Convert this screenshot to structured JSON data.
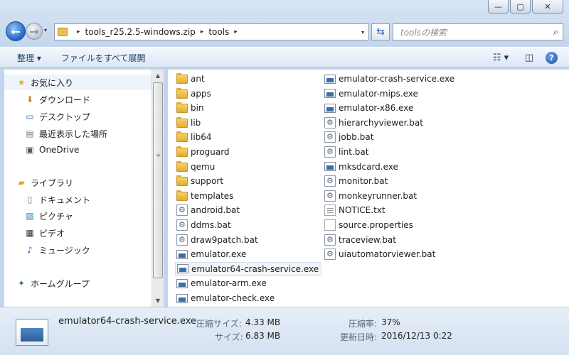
{
  "titlebar": {
    "minimize": "—",
    "maximize": "▢",
    "close": "✕"
  },
  "nav": {
    "back_icon": "←",
    "forward_icon": "→",
    "dropdown_icon": "▾"
  },
  "address": {
    "path": [
      "tools_r25.2.5-windows.zip",
      "tools"
    ],
    "separator": "▸",
    "dropdown": "▾"
  },
  "search": {
    "placeholder": "toolsの検索",
    "icon": "⌕"
  },
  "toolbar": {
    "organize": "整理 ▾",
    "expand_all": "ファイルをすべて展開",
    "view_icon": "☷ ▾",
    "preview_icon": "◫",
    "help": "?"
  },
  "sidebar": {
    "items": [
      {
        "label": "お気に入り",
        "icon": "★",
        "color": "#e3b024"
      },
      {
        "label": "ダウンロード",
        "icon": "⬇",
        "color": "#c58a24"
      },
      {
        "label": "デスクトップ",
        "icon": "▭",
        "color": "#2a5da8"
      },
      {
        "label": "最近表示した場所",
        "icon": "▤",
        "color": "#7a7a7a"
      },
      {
        "label": "OneDrive",
        "icon": "▣",
        "color": "#555555"
      },
      {
        "label": "ライブラリ",
        "icon": "▰",
        "color": "#d9a227"
      },
      {
        "label": "ドキュメント",
        "icon": "▯",
        "color": "#6a7a8c"
      },
      {
        "label": "ピクチャ",
        "icon": "▨",
        "color": "#2f7aa8"
      },
      {
        "label": "ビデオ",
        "icon": "▦",
        "color": "#333333"
      },
      {
        "label": "ミュージック",
        "icon": "♪",
        "color": "#2a6ec0"
      },
      {
        "label": "ホームグループ",
        "icon": "✦",
        "color": "#2e8b57"
      }
    ]
  },
  "files": {
    "col1": [
      {
        "name": "ant",
        "type": "folder"
      },
      {
        "name": "apps",
        "type": "folder"
      },
      {
        "name": "bin",
        "type": "folder"
      },
      {
        "name": "lib",
        "type": "folder"
      },
      {
        "name": "lib64",
        "type": "folder"
      },
      {
        "name": "proguard",
        "type": "folder"
      },
      {
        "name": "qemu",
        "type": "folder"
      },
      {
        "name": "support",
        "type": "folder"
      },
      {
        "name": "templates",
        "type": "folder"
      },
      {
        "name": "android.bat",
        "type": "bat"
      },
      {
        "name": "ddms.bat",
        "type": "bat"
      },
      {
        "name": "draw9patch.bat",
        "type": "bat"
      },
      {
        "name": "emulator.exe",
        "type": "exe"
      },
      {
        "name": "emulator64-crash-service.exe",
        "type": "exe"
      },
      {
        "name": "emulator-arm.exe",
        "type": "exe"
      },
      {
        "name": "emulator-check.exe",
        "type": "exe"
      }
    ],
    "col2": [
      {
        "name": "emulator-crash-service.exe",
        "type": "exe"
      },
      {
        "name": "emulator-mips.exe",
        "type": "exe"
      },
      {
        "name": "emulator-x86.exe",
        "type": "exe"
      },
      {
        "name": "hierarchyviewer.bat",
        "type": "bat"
      },
      {
        "name": "jobb.bat",
        "type": "bat"
      },
      {
        "name": "lint.bat",
        "type": "bat"
      },
      {
        "name": "mksdcard.exe",
        "type": "exe"
      },
      {
        "name": "monitor.bat",
        "type": "bat"
      },
      {
        "name": "monkeyrunner.bat",
        "type": "bat"
      },
      {
        "name": "NOTICE.txt",
        "type": "txt"
      },
      {
        "name": "source.properties",
        "type": "prop"
      },
      {
        "name": "traceview.bat",
        "type": "bat"
      },
      {
        "name": "uiautomatorviewer.bat",
        "type": "bat"
      }
    ]
  },
  "selected_file": "emulator64-crash-service.exe",
  "status": {
    "name": "emulator64-crash-service.exe",
    "compressed_size_label": "圧縮サイズ:",
    "compressed_size": "4.33 MB",
    "size_label": "サイズ:",
    "size": "6.83 MB",
    "ratio_label": "圧縮率:",
    "ratio": "37%",
    "modified_label": "更新日時:",
    "modified": "2016/12/13 0:22"
  }
}
